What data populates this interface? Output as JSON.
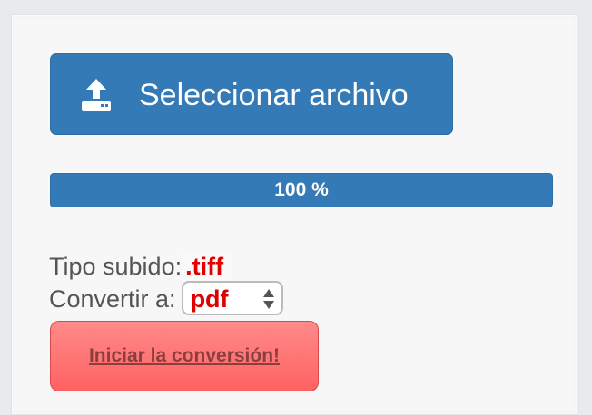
{
  "upload": {
    "label": "Seleccionar archivo",
    "icon": "upload-icon"
  },
  "progress": {
    "percent": 100,
    "label": "100 %"
  },
  "file_type": {
    "label": "Tipo subido:",
    "value": ".tiff"
  },
  "convert_to": {
    "label": "Convertir a:",
    "selected": "pdf",
    "icon": "select-arrows-icon"
  },
  "convert_button": {
    "label": "Iniciar la conversión!"
  },
  "colors": {
    "primary": "#337ab7",
    "highlight": "#e00000",
    "danger_button": "#ff6b6b"
  }
}
